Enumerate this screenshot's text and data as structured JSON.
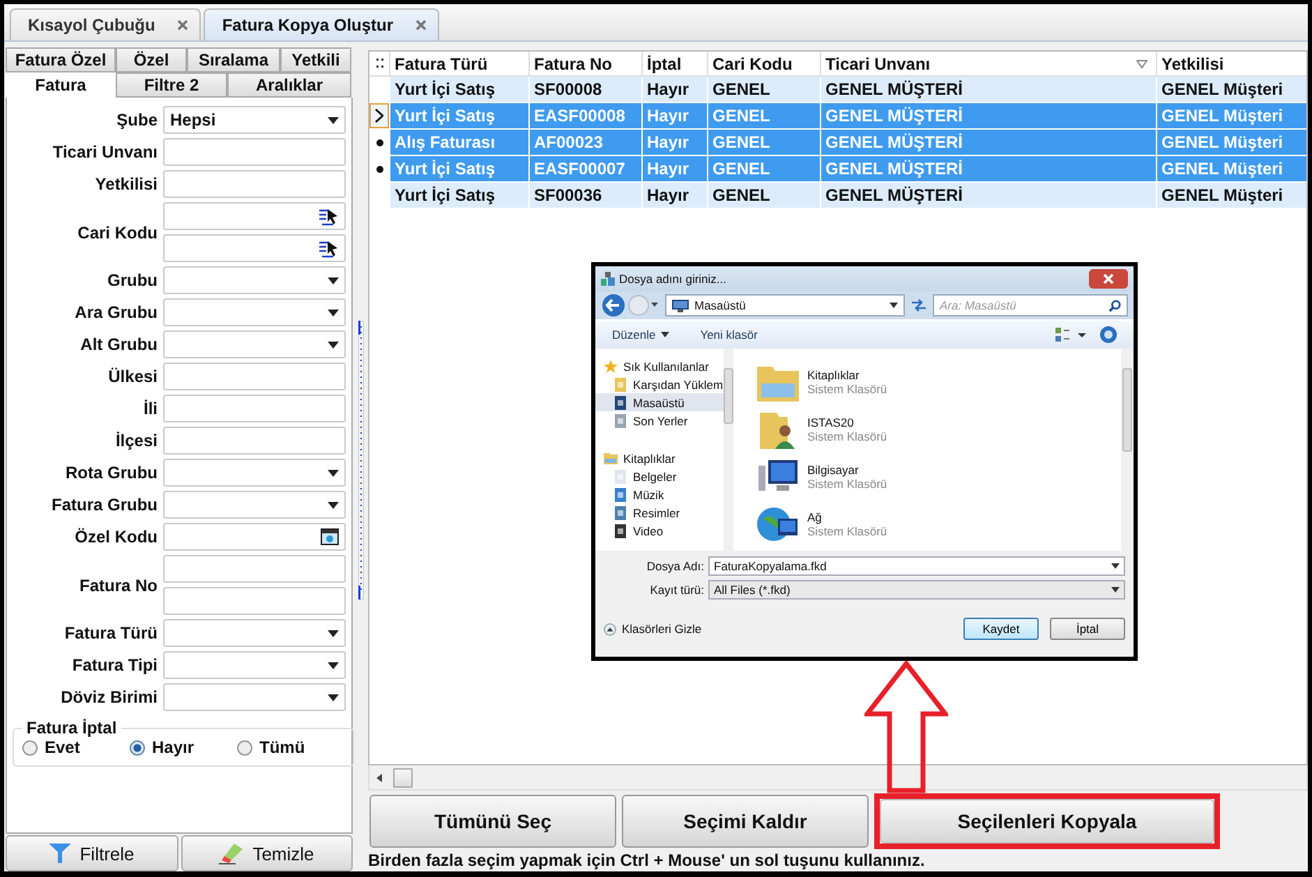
{
  "doc_tabs": [
    {
      "label": "Kısayol Çubuğu",
      "selected": false
    },
    {
      "label": "Fatura Kopya Oluştur",
      "selected": true
    }
  ],
  "filter_tabs": [
    [
      {
        "label": "Fatura Özel",
        "selected": false
      },
      {
        "label": "Özel",
        "selected": false
      },
      {
        "label": "Sıralama",
        "selected": false
      },
      {
        "label": "Yetkili",
        "selected": false
      }
    ],
    [
      {
        "label": "Fatura",
        "selected": true
      },
      {
        "label": "Filtre 2",
        "selected": false
      },
      {
        "label": "Aralıklar",
        "selected": false
      }
    ]
  ],
  "fields": [
    {
      "label": "Şube",
      "kind": "dropdown",
      "value": "Hepsi"
    },
    {
      "label": "Ticari Unvanı",
      "kind": "text"
    },
    {
      "label": "Yetkilisi",
      "kind": "text"
    },
    {
      "label": "Cari Kodu",
      "kind": "double_lookup"
    },
    {
      "label": "Grubu",
      "kind": "dropdown"
    },
    {
      "label": "Ara Grubu",
      "kind": "dropdown"
    },
    {
      "label": "Alt Grubu",
      "kind": "dropdown"
    },
    {
      "label": "Ülkesi",
      "kind": "text"
    },
    {
      "label": "İli",
      "kind": "text"
    },
    {
      "label": "İlçesi",
      "kind": "text"
    },
    {
      "label": "Rota Grubu",
      "kind": "dropdown"
    },
    {
      "label": "Fatura Grubu",
      "kind": "dropdown"
    },
    {
      "label": "Özel Kodu",
      "kind": "picker"
    },
    {
      "label": "Fatura No",
      "kind": "double_text"
    },
    {
      "label": "Fatura Türü",
      "kind": "dropdown"
    },
    {
      "label": "Fatura Tipi",
      "kind": "dropdown"
    },
    {
      "label": "Döviz Birimi",
      "kind": "dropdown"
    }
  ],
  "cancel_group": {
    "title": "Fatura İptal",
    "options": [
      {
        "label": "Evet",
        "selected": false
      },
      {
        "label": "Hayır",
        "selected": true
      },
      {
        "label": "Tümü",
        "selected": false
      }
    ]
  },
  "filter_buttons": [
    {
      "label": "Filtrele",
      "kind": "filter"
    },
    {
      "label": "Temizle",
      "kind": "clear"
    }
  ],
  "table": {
    "columns": [
      "Fatura Türü",
      "Fatura No",
      "İptal",
      "Cari Kodu",
      "Ticari Unvanı",
      "Yetkilisi"
    ],
    "rows": [
      {
        "selected": false,
        "current": false,
        "cells": [
          "Yurt İçi Satış",
          "SF00008",
          "Hayır",
          "GENEL",
          "GENEL MÜŞTERİ",
          "GENEL Müşteri"
        ]
      },
      {
        "selected": true,
        "current": true,
        "cells": [
          "Yurt İçi Satış",
          "EASF00008",
          "Hayır",
          "GENEL",
          "GENEL MÜŞTERİ",
          "GENEL Müşteri"
        ]
      },
      {
        "selected": true,
        "current": false,
        "cells": [
          "Alış Faturası",
          "AF00023",
          "Hayır",
          "GENEL",
          "GENEL MÜŞTERİ",
          "GENEL Müşteri"
        ]
      },
      {
        "selected": true,
        "current": false,
        "cells": [
          "Yurt İçi Satış",
          "EASF00007",
          "Hayır",
          "GENEL",
          "GENEL MÜŞTERİ",
          "GENEL Müşteri"
        ]
      },
      {
        "selected": false,
        "current": false,
        "cells": [
          "Yurt İçi Satış",
          "SF00036",
          "Hayır",
          "GENEL",
          "GENEL MÜŞTERİ",
          "GENEL Müşteri"
        ]
      }
    ]
  },
  "dialog": {
    "title": "Dosya adını giriniz...",
    "address": "Masaüstü",
    "search_placeholder": "Ara: Masaüstü",
    "toolbar": [
      "Düzenle",
      "Yeni klasör"
    ],
    "nav": [
      {
        "label": "Sık Kullanılanlar",
        "children": [
          {
            "label": "Karşıdan Yüklem",
            "selected": false
          },
          {
            "label": "Masaüstü",
            "selected": true
          },
          {
            "label": "Son Yerler",
            "selected": false
          }
        ]
      },
      {
        "label": "Kitaplıklar",
        "children": [
          {
            "label": "Belgeler",
            "selected": false
          },
          {
            "label": "Müzik",
            "selected": false
          },
          {
            "label": "Resimler",
            "selected": false
          },
          {
            "label": "Video",
            "selected": false
          }
        ]
      }
    ],
    "items": [
      {
        "name": "Kitaplıklar",
        "subtitle": "Sistem Klasörü"
      },
      {
        "name": "ISTAS20",
        "subtitle": "Sistem Klasörü"
      },
      {
        "name": "Bilgisayar",
        "subtitle": "Sistem Klasörü"
      },
      {
        "name": "Ağ",
        "subtitle": "Sistem Klasörü"
      }
    ],
    "filename_label": "Dosya Adı:",
    "filename": "FaturaKopyalama.fkd",
    "type_label": "Kayıt türü:",
    "type": "All Files (*.fkd)",
    "hide_folders": "Klasörleri Gizle",
    "buttons": [
      "Kaydet",
      "İptal"
    ]
  },
  "actions": [
    {
      "label": "Tümünü Seç",
      "highlighted": false
    },
    {
      "label": "Seçimi Kaldır",
      "highlighted": false
    },
    {
      "label": "Seçilenleri Kopyala",
      "highlighted": true
    }
  ],
  "hint": "Birden fazla seçim yapmak için Ctrl + Mouse' un sol tuşunu kullanınız."
}
